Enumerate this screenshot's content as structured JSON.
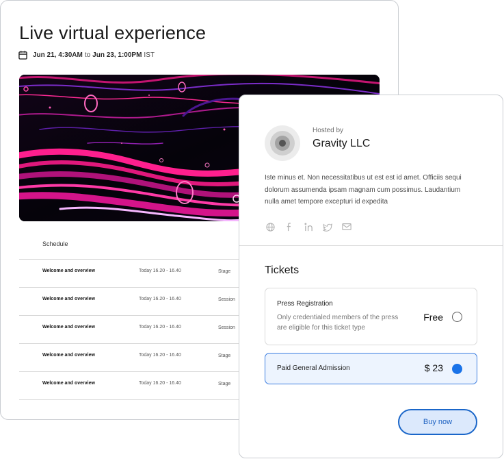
{
  "event": {
    "title": "Live virtual experience",
    "date": {
      "start": "Jun 21, 4:30AM",
      "separator": "to",
      "end": "Jun 23, 1:00PM",
      "timezone": "IST"
    },
    "hero_image": "abstract pink and purple fluid art",
    "schedule": {
      "header": "Schedule",
      "rows": [
        {
          "title": "Welcome and overview",
          "time": "Today  16.20 - 16.40",
          "type": "Stage"
        },
        {
          "title": "Welcome and overview",
          "time": "Today  16.20 - 16.40",
          "type": "Session"
        },
        {
          "title": "Welcome and overview",
          "time": "Today  16.20 - 16.40",
          "type": "Session"
        },
        {
          "title": "Welcome and overview",
          "time": "Today  16.20 - 16.40",
          "type": "Stage"
        },
        {
          "title": "Welcome and overview",
          "time": "Today  16.20 - 16.40",
          "type": "Stage"
        }
      ]
    }
  },
  "host": {
    "hosted_by_label": "Hosted by",
    "name": "Gravity LLC",
    "description": "Iste minus et. Non necessitatibus ut est est id amet. Officiis sequi dolorum assumenda ipsam magnam cum possimus. Laudantium nulla amet tempore excepturi id expedita",
    "socials": [
      "globe-icon",
      "facebook-icon",
      "linkedin-icon",
      "twitter-icon",
      "mail-icon"
    ]
  },
  "tickets": {
    "title": "Tickets",
    "options": [
      {
        "name": "Press Registration",
        "description": "Only credentialed members of the press are eligible for this ticket type",
        "price": "Free",
        "selected": false
      },
      {
        "name": "Paid General Admission",
        "description": "",
        "price": "$ 23",
        "selected": true
      }
    ],
    "buy_label": "Buy now"
  },
  "colors": {
    "accent": "#1a73e8",
    "selected_bg": "#edf4fe",
    "button_bg": "#dce9fc",
    "hero_pink": "#ff1f8e",
    "hero_purple": "#7b2cc9"
  }
}
